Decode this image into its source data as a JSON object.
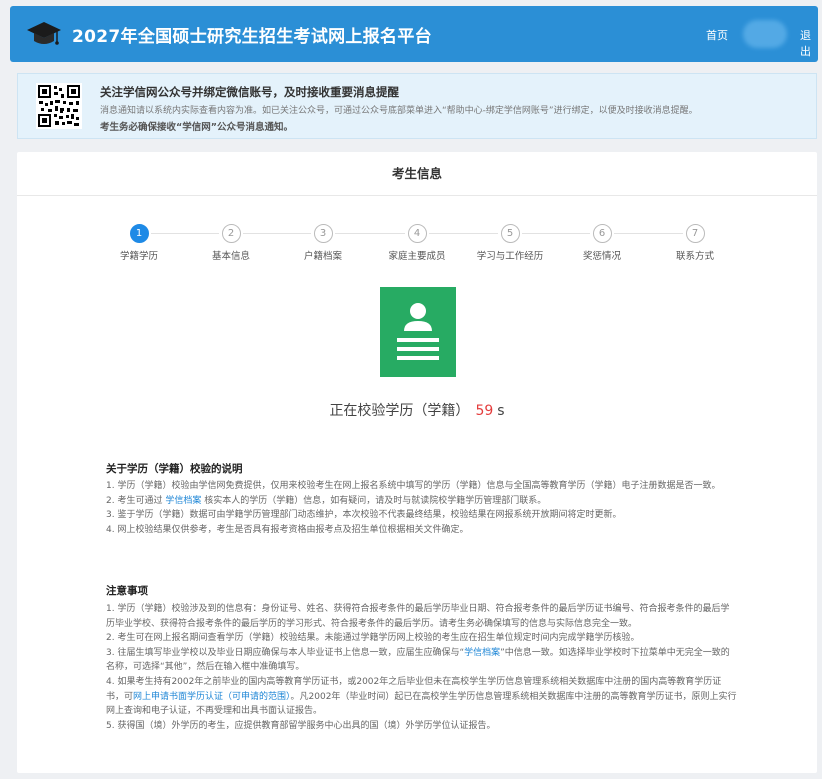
{
  "header": {
    "title": "2027年全国硕士研究生招生考试网上报名平台",
    "nav_home": "首页",
    "nav_logout": "退出",
    "brand_color": "#2b8fd6",
    "logo_icon": "graduation-cap-icon"
  },
  "notice": {
    "title": "关注学信网公众号并绑定微信账号，及时接收重要消息提醒",
    "body": "消息通知请以系统内实际查看内容为准。如已关注公众号，可通过公众号底部菜单进入“帮助中心-绑定学信网账号”进行绑定，以便及时接收消息提醒。",
    "strong": "考生务必确保接收“学信网”公众号消息通知。",
    "qr_icon": "qr-code-icon"
  },
  "card": {
    "title": "考生信息"
  },
  "steps": [
    {
      "num": "1",
      "label": "学籍学历",
      "active": true
    },
    {
      "num": "2",
      "label": "基本信息",
      "active": false
    },
    {
      "num": "3",
      "label": "户籍档案",
      "active": false
    },
    {
      "num": "4",
      "label": "家庭主要成员",
      "active": false
    },
    {
      "num": "5",
      "label": "学习与工作经历",
      "active": false
    },
    {
      "num": "6",
      "label": "奖惩情况",
      "active": false
    },
    {
      "num": "7",
      "label": "联系方式",
      "active": false
    }
  ],
  "status": {
    "text": "正在校验学历（学籍）",
    "countdown": "59",
    "unit": "s",
    "icon": "user-document-icon",
    "icon_color": "#27ab63",
    "countdown_color": "#e43d3d"
  },
  "about": {
    "title": "关于学历（学籍）校验的说明",
    "items": [
      {
        "pre": "1. 学历（学籍）校验由学信网免费提供，仅用来校验考生在网上报名系统中填写的学历（学籍）信息与全国高等教育学历（学籍）电子注册数据是否一致。"
      },
      {
        "pre": "2. 考生可通过 ",
        "link": "学信档案",
        "post": " 核实本人的学历（学籍）信息，如有疑问，请及时与就读院校学籍学历管理部门联系。"
      },
      {
        "pre": "3. 鉴于学历（学籍）数据可由学籍学历管理部门动态维护，本次校验不代表最终结果，校验结果在网报系统开放期间将定时更新。"
      },
      {
        "pre": "4. 网上校验结果仅供参考，考生是否具有报考资格由报考点及招生单位根据相关文件确定。"
      }
    ]
  },
  "notes": {
    "title": "注意事项",
    "items": [
      {
        "pre": "1. 学历（学籍）校验涉及到的信息有：身份证号、姓名、获得符合报考条件的最后学历毕业日期、符合报考条件的最后学历证书编号、符合报考条件的最后学历毕业学校、获得符合报考条件的最后学历的学习形式、符合报考条件的最后学历。请考生务必确保填写的信息与实际信息完全一致。"
      },
      {
        "pre": "2. 考生可在网上报名期间查看学历（学籍）校验结果。未能通过学籍学历网上校验的考生应在招生单位规定时间内完成学籍学历核验。"
      },
      {
        "pre": "3. 往届生填写毕业学校以及毕业日期应确保与本人毕业证书上信息一致，应届生应确保与“",
        "link": "学信档案",
        "post": "”中信息一致。如选择毕业学校时下拉菜单中无完全一致的名称，可选择“其他”，然后在输入框中准确填写。"
      },
      {
        "pre": "4. 如果考生持有2002年之前毕业的国内高等教育学历证书，或2002年之后毕业但未在高校学生学历信息管理系统相关数据库中注册的国内高等教育学历证书，可",
        "link": "网上申请书面学历认证（可申请的范围）",
        "post": "。凡2002年（毕业时间）起已在高校学生学历信息管理系统相关数据库中注册的高等教育学历证书，原则上实行网上查询和电子认证，不再受理和出具书面认证报告。"
      },
      {
        "pre": "5. 获得国（境）外学历的考生，应提供教育部留学服务中心出具的国（境）外学历学位认证报告。"
      }
    ]
  }
}
